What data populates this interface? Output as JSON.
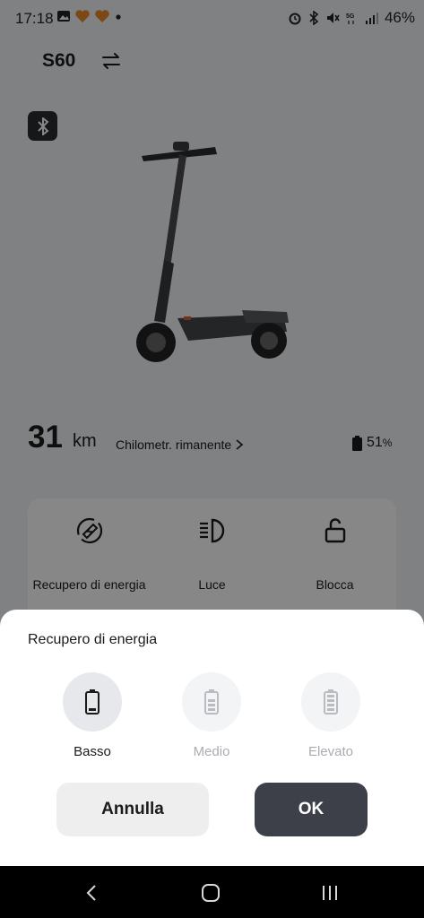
{
  "status_bar": {
    "time": "17:18",
    "battery": "46%"
  },
  "header": {
    "title": "S60"
  },
  "range": {
    "value": "31",
    "unit": "km",
    "label": "Chilometr. rimanente",
    "battery_value": "51",
    "battery_unit": "%"
  },
  "features": [
    {
      "label": "Recupero di energia",
      "icon": "energy-recovery-icon"
    },
    {
      "label": "Luce",
      "icon": "headlight-icon"
    },
    {
      "label": "Blocca",
      "icon": "unlock-icon"
    }
  ],
  "sheet": {
    "title": "Recupero di energia",
    "options": [
      {
        "label": "Basso",
        "selected": true
      },
      {
        "label": "Medio",
        "selected": false
      },
      {
        "label": "Elevato",
        "selected": false
      }
    ],
    "cancel_label": "Annulla",
    "ok_label": "OK"
  },
  "colors": {
    "ok_button": "#3d4048",
    "overlay": "#000000"
  }
}
